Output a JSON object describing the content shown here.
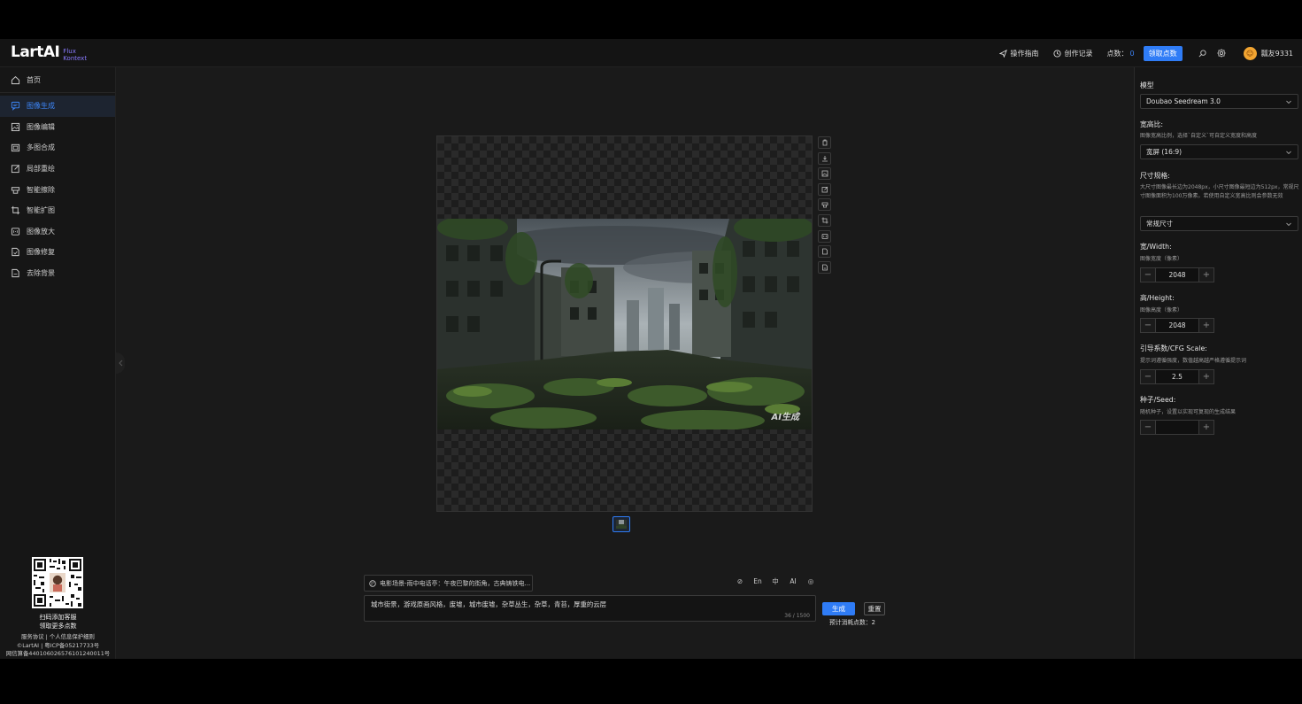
{
  "header": {
    "logo_main": "LartAI",
    "logo_sub1": "Flux",
    "logo_sub2": "Kontext",
    "guide": "操作指南",
    "history": "创作记录",
    "points_label": "点数：",
    "points_value": "0",
    "get_points": "领取点数",
    "username": "瓢友9331",
    "avatar_glyph": "☺"
  },
  "sidebar": {
    "home": "首页",
    "items": [
      {
        "label": "图像生成",
        "icon": "chat-square-icon"
      },
      {
        "label": "图像编辑",
        "icon": "image-icon"
      },
      {
        "label": "多图合成",
        "icon": "layers-icon"
      },
      {
        "label": "局部重绘",
        "icon": "edit-icon"
      },
      {
        "label": "智能擦除",
        "icon": "eraser-icon"
      },
      {
        "label": "智能扩图",
        "icon": "crop-icon"
      },
      {
        "label": "图像放大",
        "icon": "upscale-icon"
      },
      {
        "label": "图像修复",
        "icon": "repair-icon"
      },
      {
        "label": "去除背景",
        "icon": "remove-bg-icon"
      }
    ],
    "footer": {
      "line1": "扫码添加客服",
      "line2": "领取更多点数",
      "line3": "服务协议 | 个人信息保护细则",
      "line4": "©LartAI | 粤ICP备05217733号",
      "line5": "网信算备440106026576101240011号"
    }
  },
  "canvas": {
    "watermark": "AI生成"
  },
  "prompt": {
    "template": "电影场景-雨中电话亭：午夜巴黎的街角，古典铸铁电...",
    "tools": [
      "⊘",
      "En",
      "中",
      "AI",
      "◎"
    ],
    "text": "城市街景，游戏原画风格，废墟，城市废墟，杂草丛生，杂草，青苔，厚重的云层",
    "counter": "36 / 1500",
    "generate": "生成",
    "reset": "重置",
    "cost_label": "预计消耗点数：",
    "cost_value": "2"
  },
  "settings": {
    "model_label": "模型",
    "model_value": "Doubao Seedream 3.0",
    "aspect_label": "宽高比:",
    "aspect_hint": "图像宽高比例，选择`自定义`可自定义宽度和高度",
    "aspect_value": "宽屏 (16:9)",
    "size_label": "尺寸规格:",
    "size_hint": "大尺寸图像最长边为2048px，小尺寸图像最短边为512px，常规尺寸图像面积为100万像素。若使用自定义宽高比则会参数无效",
    "size_value": "常规尺寸",
    "width_label": "宽/Width:",
    "width_hint": "图像宽度（像素）",
    "width_value": "2048",
    "height_label": "高/Height:",
    "height_hint": "图像高度（像素）",
    "height_value": "2048",
    "cfg_label": "引导系数/CFG Scale:",
    "cfg_hint": "提示词遵循强度，数值越高越严格遵循提示词",
    "cfg_value": "2.5",
    "seed_label": "种子/Seed:",
    "seed_hint": "随机种子，设置以实现可复现的生成结果",
    "seed_value": "",
    "minus": "−",
    "plus": "+"
  }
}
